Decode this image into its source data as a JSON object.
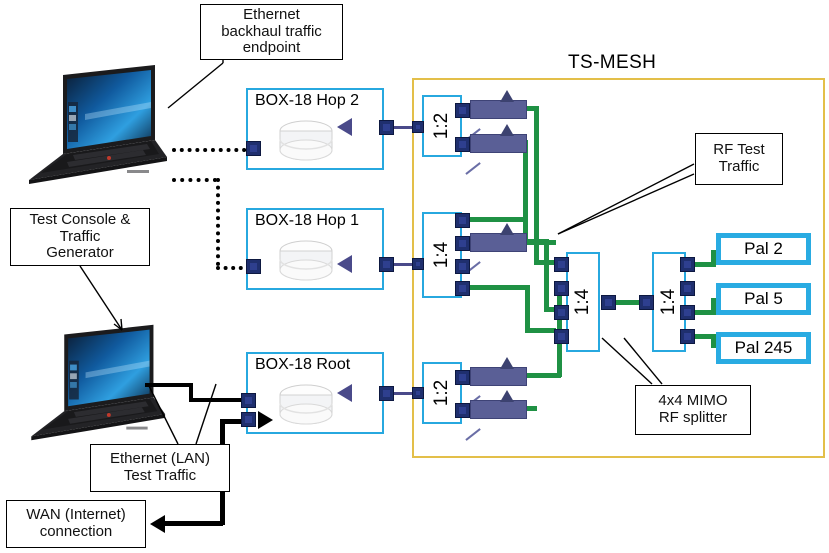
{
  "diagram": {
    "title": "TS-MESH",
    "mesh_enclosure_color": "#e3bf49",
    "device_border_color": "#27a8df",
    "rf_wire_color": "#1f9144",
    "ethernet_wire_color": "#000000",
    "backhaul_wire_color": "#4a4a8a"
  },
  "annotations": {
    "ethernet_backhaul": "Ethernet\nbackhaul traffic\nendpoint",
    "test_console": "Test Console &\nTraffic\nGenerator",
    "rf_test_traffic": "RF Test\nTraffic",
    "mimo_splitter": "4x4 MIMO\nRF splitter",
    "ethernet_lan": "Ethernet (LAN)\nTest Traffic",
    "wan_connection": "WAN (Internet)\nconnection"
  },
  "devices": [
    {
      "label": "BOX-18 Hop 2",
      "role": "mesh-node-hop2"
    },
    {
      "label": "BOX-18 Hop 1",
      "role": "mesh-node-hop1"
    },
    {
      "label": "BOX-18 Root",
      "role": "mesh-node-root"
    }
  ],
  "splitters": {
    "hop2": {
      "ratio": "1:2",
      "ports": 2
    },
    "hop1": {
      "ratio": "1:4",
      "ports": 4
    },
    "root": {
      "ratio": "1:2",
      "ports": 2
    },
    "combine": {
      "ratio": "1:4",
      "ports": 4
    },
    "fanout": {
      "ratio": "1:4",
      "ports": 4
    }
  },
  "endpoints": [
    {
      "label": "Pal 2"
    },
    {
      "label": "Pal 5"
    },
    {
      "label": "Pal 245"
    }
  ],
  "hosts": [
    {
      "name": "backhaul-endpoint-laptop",
      "os_wallpaper": "windows-10"
    },
    {
      "name": "test-console-laptop",
      "os_wallpaper": "windows-10"
    }
  ]
}
